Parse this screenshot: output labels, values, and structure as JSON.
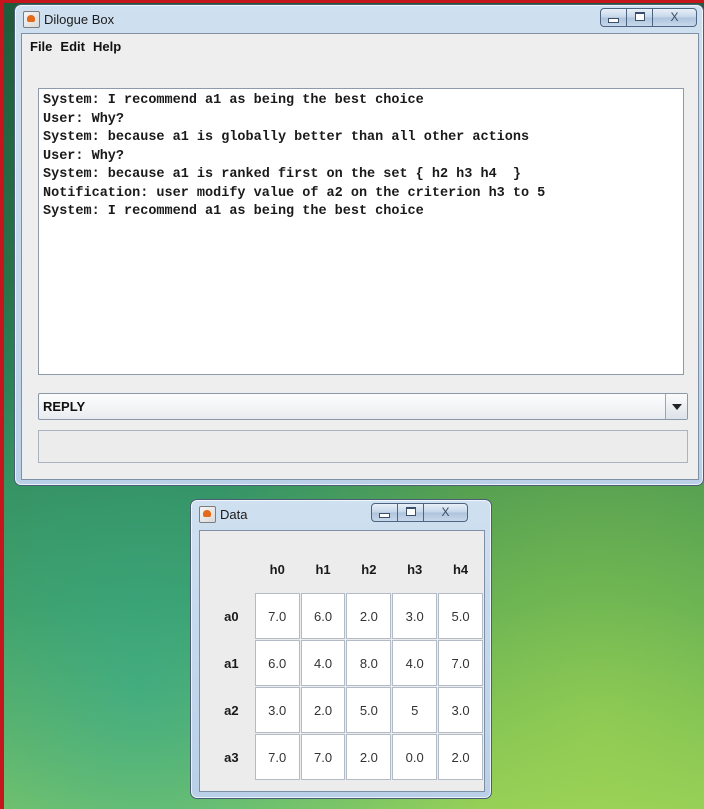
{
  "dialogue_window": {
    "title": "Dilogue Box",
    "menu": [
      "File",
      "Edit",
      "Help"
    ],
    "transcript": [
      "System: I recommend a1 as being the best choice",
      "User: Why?",
      "System: because a1 is globally better than all other actions",
      "User: Why?",
      "System: because a1 is ranked first on the set { h2 h3 h4  }",
      "Notification: user modify value of a2 on the criterion h3 to 5",
      "System: I recommend a1 as being the best choice"
    ],
    "reply_selected": "REPLY",
    "input_value": ""
  },
  "data_window": {
    "title": "Data",
    "columns": [
      "h0",
      "h1",
      "h2",
      "h3",
      "h4"
    ],
    "rows": [
      {
        "label": "a0",
        "cells": [
          "7.0",
          "6.0",
          "2.0",
          "3.0",
          "5.0"
        ]
      },
      {
        "label": "a1",
        "cells": [
          "6.0",
          "4.0",
          "8.0",
          "4.0",
          "7.0"
        ]
      },
      {
        "label": "a2",
        "cells": [
          "3.0",
          "2.0",
          "5.0",
          "5",
          "3.0"
        ]
      },
      {
        "label": "a3",
        "cells": [
          "7.0",
          "7.0",
          "2.0",
          "0.0",
          "2.0"
        ]
      }
    ]
  },
  "window_controls": {
    "minimize_icon": "minimize-icon",
    "maximize_icon": "maximize-icon",
    "close_label": "X"
  },
  "colors": {
    "desktop_top": "#1f5a3b",
    "desktop_bottom": "#8cc95a",
    "window_frame": "#b9d0e8",
    "accent_red": "#c4161c"
  }
}
